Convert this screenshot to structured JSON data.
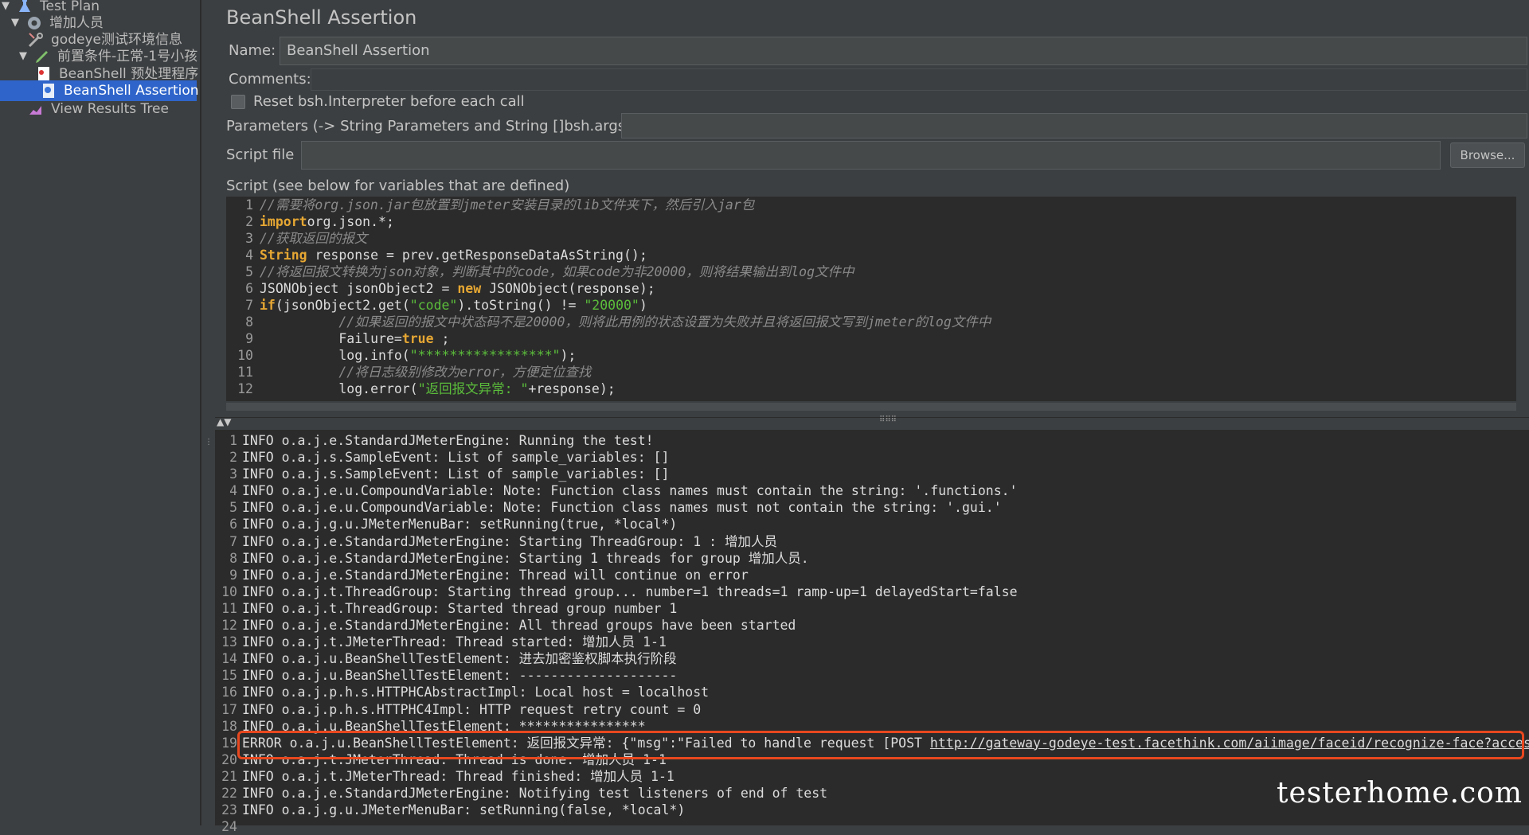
{
  "tree": {
    "items": [
      {
        "label": "Test Plan",
        "icon": "flask-icon",
        "arrow": "▼"
      },
      {
        "label": "增加人员",
        "icon": "gear-icon",
        "arrow": "▼"
      },
      {
        "label": "godeye测试环境信息",
        "icon": "wrench-icon",
        "arrow": ""
      },
      {
        "label": "前置条件-正常-1号小孩",
        "icon": "pencil-icon",
        "arrow": "▼"
      },
      {
        "label": "BeanShell 预处理程序",
        "icon": "script-icon",
        "arrow": ""
      },
      {
        "label": "BeanShell Assertion",
        "icon": "assertion-icon",
        "arrow": ""
      },
      {
        "label": "View Results Tree",
        "icon": "chart-icon",
        "arrow": ""
      }
    ],
    "selected_index": 5
  },
  "panel": {
    "title": "BeanShell Assertion",
    "name_label": "Name:",
    "name_value": "BeanShell Assertion",
    "comments_label": "Comments:",
    "reset_label": "Reset bsh.Interpreter before each call",
    "params_label": "Parameters (-> String Parameters and String []bsh.args)",
    "script_file_label": "Script file",
    "browse_label": "Browse...",
    "script_label": "Script (see below for variables that are defined)"
  },
  "script_lines": [
    [
      [
        "cm",
        "//需要将org.json.jar包放置到jmeter安装目录的lib文件夹下，然后引入jar包"
      ]
    ],
    [
      [
        "kw",
        "import"
      ],
      [
        "",
        "org.json.*;"
      ]
    ],
    [
      [
        "cm",
        "//获取返回的报文"
      ]
    ],
    [
      [
        "kw",
        "String"
      ],
      [
        "",
        " response = prev.getResponseDataAsString();"
      ]
    ],
    [
      [
        "cm",
        "//将返回报文转换为json对象，判断其中的code，如果code为非20000，则将结果输出到log文件中"
      ]
    ],
    [
      [
        "",
        "JSONObject jsonObject2 = "
      ],
      [
        "kw",
        "new"
      ],
      [
        "",
        " JSONObject(response);"
      ]
    ],
    [
      [
        "kw",
        "if"
      ],
      [
        "",
        "(jsonObject2.get("
      ],
      [
        "st",
        "\"code\""
      ],
      [
        "",
        ").toString() != "
      ],
      [
        "st",
        "\"20000\""
      ],
      [
        "",
        ")"
      ]
    ],
    [
      [
        "",
        "          "
      ],
      [
        "cm",
        "//如果返回的报文中状态码不是20000，则将此用例的状态设置为失败并且将返回报文写到jmeter的log文件中"
      ]
    ],
    [
      [
        "",
        "          Failure="
      ],
      [
        "kw",
        "true"
      ],
      [
        "",
        " ;"
      ]
    ],
    [
      [
        "",
        "          log.info("
      ],
      [
        "st",
        "\"*****************\""
      ],
      [
        "",
        ");"
      ]
    ],
    [
      [
        "",
        "          "
      ],
      [
        "cm",
        "//将日志级别修改为error，方便定位查找"
      ]
    ],
    [
      [
        "",
        "          log.error("
      ],
      [
        "st",
        "\"返回报文异常: \""
      ],
      [
        "",
        "+response);"
      ]
    ]
  ],
  "log_lines": [
    "INFO o.a.j.e.StandardJMeterEngine: Running the test!",
    "INFO o.a.j.s.SampleEvent: List of sample_variables: []",
    "INFO o.a.j.s.SampleEvent: List of sample_variables: []",
    "INFO o.a.j.e.u.CompoundVariable: Note: Function class names must contain the string: '.functions.'",
    "INFO o.a.j.e.u.CompoundVariable: Note: Function class names must not contain the string: '.gui.'",
    "INFO o.a.j.g.u.JMeterMenuBar: setRunning(true, *local*)",
    "INFO o.a.j.e.StandardJMeterEngine: Starting ThreadGroup: 1 : 增加人员",
    "INFO o.a.j.e.StandardJMeterEngine: Starting 1 threads for group 增加人员.",
    "INFO o.a.j.e.StandardJMeterEngine: Thread will continue on error",
    "INFO o.a.j.t.ThreadGroup: Starting thread group... number=1 threads=1 ramp-up=1 delayedStart=false",
    "INFO o.a.j.t.ThreadGroup: Started thread group number 1",
    "INFO o.a.j.e.StandardJMeterEngine: All thread groups have been started",
    "INFO o.a.j.t.JMeterThread: Thread started: 增加人员 1-1",
    "INFO o.a.j.u.BeanShellTestElement: 进去加密鉴权脚本执行阶段",
    "INFO o.a.j.u.BeanShellTestElement: --------------------",
    "INFO o.a.j.p.h.s.HTTPHCAbstractImpl: Local host = localhost",
    "INFO o.a.j.p.h.s.HTTPHC4Impl: HTTP request retry count = 0",
    "INFO o.a.j.u.BeanShellTestElement: ****************",
    "ERROR o.a.j.u.BeanShellTestElement: 返回报文异常: {\"msg\":\"Failed to handle request [POST ",
    "INFO o.a.j.t.JMeterThread: Thread is done: 增加人员 1-1",
    "INFO o.a.j.t.JMeterThread: Thread finished: 增加人员 1-1",
    "INFO o.a.j.e.StandardJMeterEngine: Notifying test listeners of end of test",
    "INFO o.a.j.g.u.JMeterMenuBar: setRunning(false, *local*)",
    ""
  ],
  "error_link": "http://gateway-godeye-test.facethink.com/aiimage/faceid/recognize-face?access",
  "watermark": "testerhome.com",
  "colors": {
    "selection": "#2f65ca",
    "highlight_box": "#e8481f",
    "keyword": "#e6a733",
    "string": "#5bbd3b"
  }
}
